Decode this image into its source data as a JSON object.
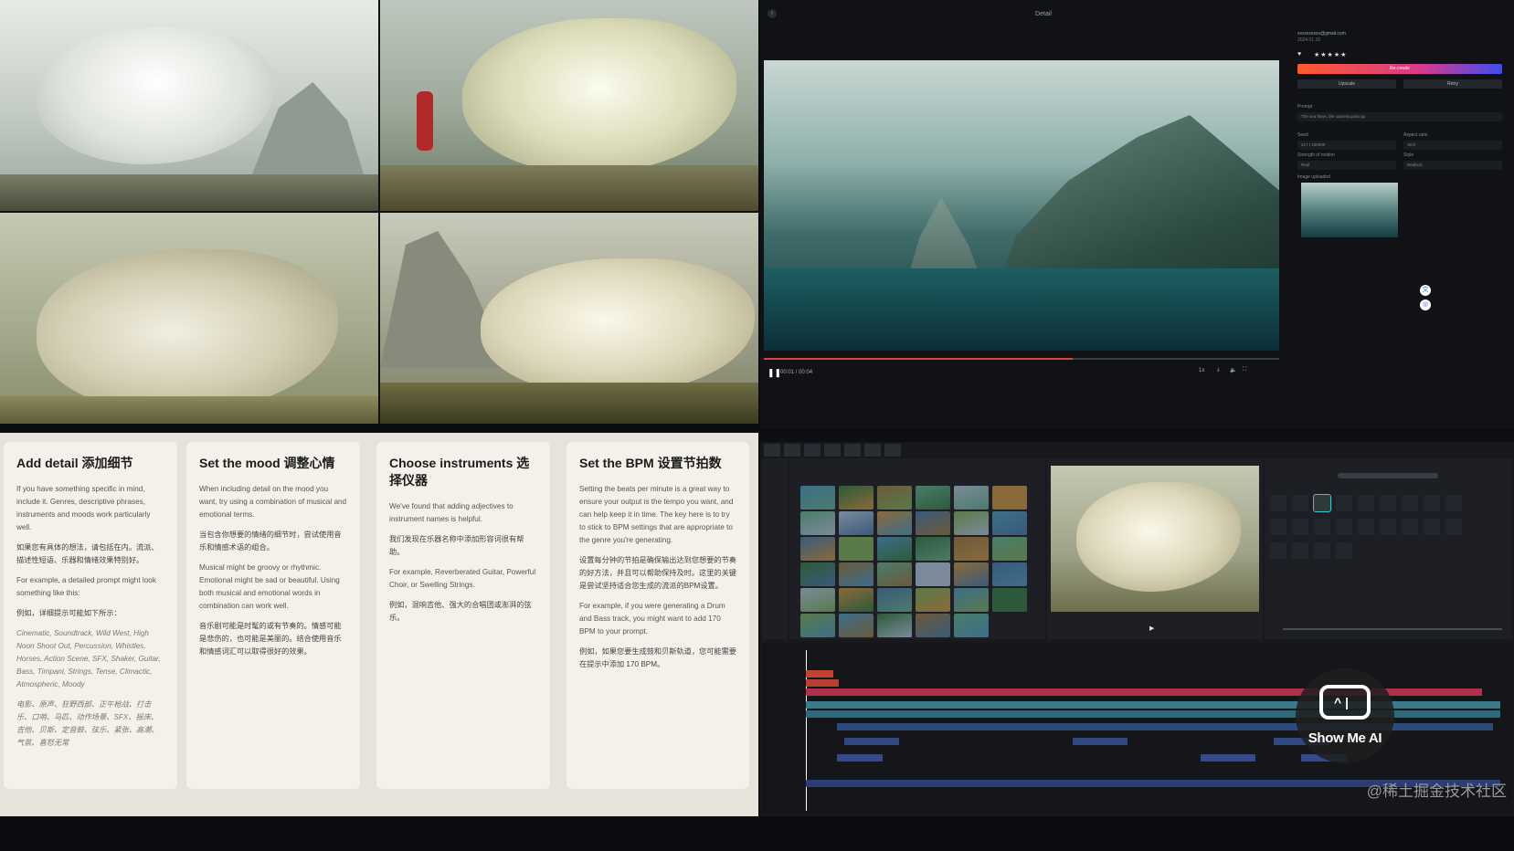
{
  "detail": {
    "title": "Detail",
    "back_icon": "back-icon",
    "email": "xxxxxxxxxx@gmail.com",
    "date": "2024.01.10",
    "stars": "★★★★★",
    "generate_label": "Re-create",
    "upscale_label": "Upscale",
    "retry_label": "Retry",
    "prompt_label": "Prompt",
    "prompt_value": "The sea flows, the camera pans up",
    "seed_label": "Seed",
    "seed_value": "217 / 100000",
    "aspect_label": "Aspect ratio",
    "aspect_value": "16:9",
    "strength_label": "Strength of motion",
    "strength_value": "Real",
    "style_label": "Style",
    "style_value": "Realistic",
    "image_label": "Image uploaded",
    "time": "00:01 / 00:04",
    "progress_fraction": 0.6
  },
  "cards": [
    {
      "title": "Add detail 添加细节",
      "body": "If you have something specific in mind, include it. Genres, descriptive phrases, instruments and moods work particularly well.",
      "body_zh": "如果您有具体的想法，请包括在内。流派、描述性短语、乐器和情绪效果特别好。",
      "example": "For example, a detailed prompt might look something like this:",
      "example_zh": "例如，详细提示可能如下所示：",
      "prompt": "Cinematic, Soundtrack, Wild West, High Noon Shoot Out, Percussion, Whistles, Horses, Action Scene, SFX, Shaker, Guitar, Bass, Timpani, Strings, Tense, Climactic, Atmospheric, Moody",
      "prompt_zh": "电影、原声、狂野西部、正午枪战、打击乐、口哨、马匹、动作场景、SFX、摇床、吉他、贝斯、定音鼓、弦乐、紧张、高潮、气氛、喜怒无常"
    },
    {
      "title": "Set the mood 调整心情",
      "body": "When including detail on the mood you want, try using a combination of musical and emotional terms.",
      "body_zh": "当包含你想要的情绪的细节时，尝试使用音乐和情感术语的组合。",
      "example": "Musical might be groovy or rhythmic. Emotional might be sad or beautiful. Using both musical and emotional words in combination can work well.",
      "example_zh": "音乐剧可能是时髦的或有节奏的。情感可能是悲伤的，也可能是美丽的。结合使用音乐和情感词汇可以取得很好的效果。"
    },
    {
      "title": "Choose instruments 选择仪器",
      "body": "We've found that adding adjectives to instrument names is helpful.",
      "body_zh": "我们发现在乐器名称中添加形容词很有帮助。",
      "example": "For example, Reverberated Guitar, Powerful Choir, or Swelling Strings.",
      "example_zh": "例如，混响吉他、强大的合唱团或澎湃的弦乐。"
    },
    {
      "title": "Set the BPM 设置节拍数",
      "body": "Setting the beats per minute is a great way to ensure your output is the tempo you want, and can help keep it in time. The key here is to try to stick to BPM settings that are appropriate to the genre you're generating.",
      "body_zh": "设置每分钟的节拍是确保输出达到您想要的节奏的好方法，并且可以帮助保持及时。这里的关键是尝试坚持适合您生成的流派的BPM设置。",
      "example": "For example, if you were generating a Drum and Bass track, you might want to add 170 BPM to your prompt.",
      "example_zh": "例如，如果您要生成鼓和贝斯轨道，您可能需要在提示中添加 170 BPM。"
    }
  ],
  "badge": {
    "text": "Show Me AI"
  },
  "watermark": "@稀土掘金技术社区",
  "colors": {
    "accent": "#e04343",
    "gradient_start": "#ff5a2c",
    "gradient_end": "#3d4df0"
  }
}
